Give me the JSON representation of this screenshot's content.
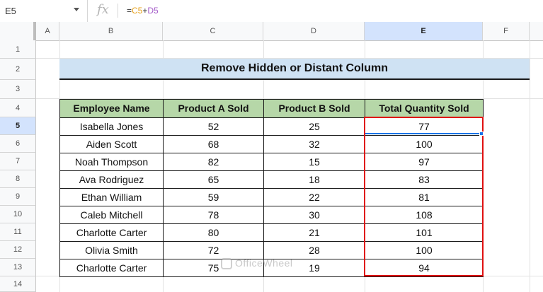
{
  "formula_bar": {
    "name_box": "E5",
    "fx_symbol": "fx",
    "formula_prefix": "=",
    "formula_ref1": "C5",
    "formula_op": "+",
    "formula_ref2": "D5"
  },
  "columns": [
    "A",
    "B",
    "C",
    "D",
    "E",
    "F"
  ],
  "rows": [
    "1",
    "2",
    "3",
    "4",
    "5",
    "6",
    "7",
    "8",
    "9",
    "10",
    "11",
    "12",
    "13",
    "14"
  ],
  "active_column": "E",
  "active_row": "5",
  "title": "Remove Hidden or Distant Column",
  "table": {
    "headers": [
      "Employee Name",
      "Product A Sold",
      "Product B Sold",
      "Total Quantity Sold"
    ],
    "rows": [
      [
        "Isabella Jones",
        "52",
        "25",
        "77"
      ],
      [
        "Aiden Scott",
        "68",
        "32",
        "100"
      ],
      [
        "Noah Thompson",
        "82",
        "15",
        "97"
      ],
      [
        "Ava Rodriguez",
        "65",
        "18",
        "83"
      ],
      [
        "Ethan William",
        "59",
        "22",
        "81"
      ],
      [
        "Caleb Mitchell",
        "78",
        "30",
        "108"
      ],
      [
        "Charlotte Carter",
        "80",
        "21",
        "101"
      ],
      [
        "Olivia Smith",
        "72",
        "28",
        "100"
      ],
      [
        "Charlotte Carter",
        "75",
        "19",
        "94"
      ]
    ]
  },
  "colors": {
    "title_fill": "#cfe2f3",
    "header_fill": "#b6d7a8",
    "highlight_border": "#e01010",
    "selection": "#1a73e8"
  },
  "watermark": "OfficeWheel"
}
